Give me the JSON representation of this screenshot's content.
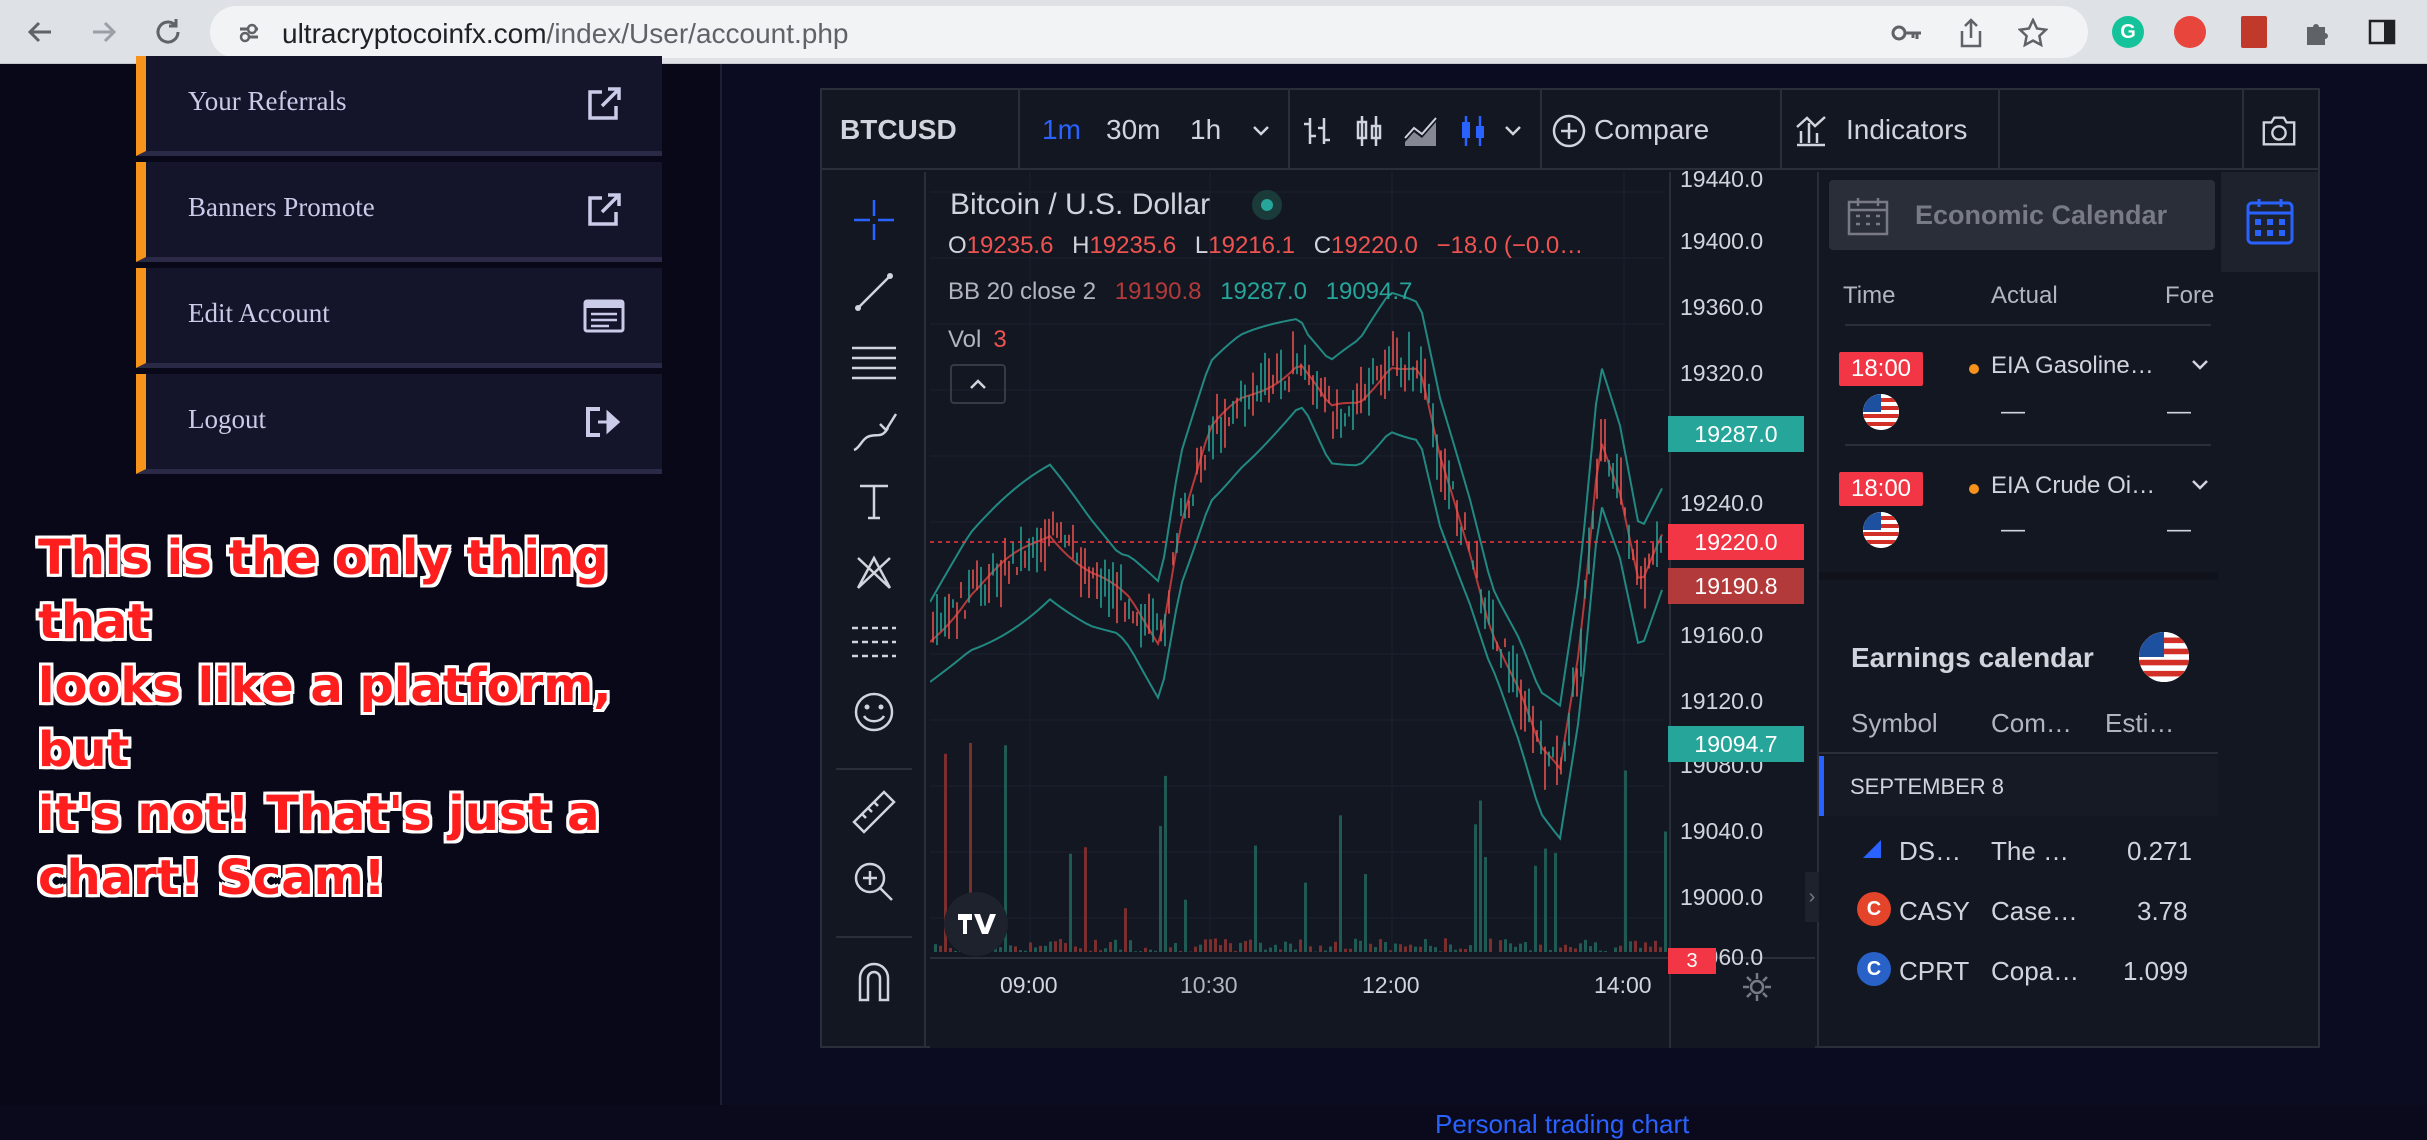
{
  "browser": {
    "url_domain": "ultracryptocoinfx.com",
    "url_path": "/index/User/account.php"
  },
  "sidebar": {
    "items": [
      {
        "label": "Your Referrals",
        "icon": "external-link-icon"
      },
      {
        "label": "Banners Promote",
        "icon": "external-link-icon"
      },
      {
        "label": "Edit Account",
        "icon": "account-card-icon"
      },
      {
        "label": "Logout",
        "icon": "logout-icon"
      }
    ]
  },
  "annotation": {
    "lines": [
      "This is the only thing that",
      "looks like a platform, but",
      "it's not! That's just a",
      "chart! Scam!"
    ]
  },
  "toolbar": {
    "symbol": "BTCUSD",
    "intervals": [
      "1m",
      "30m",
      "1h"
    ],
    "active_interval": "1m",
    "compare_label": "Compare",
    "indicators_label": "Indicators"
  },
  "chart": {
    "title": "Bitcoin / U.S. Dollar",
    "ohlc": {
      "o_label": "O",
      "o": "19235.6",
      "h_label": "H",
      "h": "19235.6",
      "l_label": "L",
      "l": "19216.1",
      "c_label": "C",
      "c": "19220.0",
      "change": "−18.0 (−0.0…"
    },
    "bb": {
      "label": "BB",
      "params": "20 close 2",
      "basis": "19190.8",
      "upper": "19287.0",
      "lower": "19094.7"
    },
    "vol": {
      "label": "Vol",
      "value": "3"
    },
    "y_ticks": [
      "19440.0",
      "19400.0",
      "19360.0",
      "19320.0",
      "19240.0",
      "19160.0",
      "19120.0",
      "19080.0",
      "19040.0",
      "19000.0",
      "18960.0"
    ],
    "price_tags": [
      {
        "value": "19287.0",
        "color": "#26a69a"
      },
      {
        "value": "19220.0",
        "color": "#f23645"
      },
      {
        "value": "19190.8",
        "color": "#b33a3a"
      },
      {
        "value": "19094.7",
        "color": "#26a69a"
      }
    ],
    "vol_tag": "3",
    "x_ticks": [
      "09:00",
      "10:30",
      "12:00",
      "14:00"
    ],
    "caption": "Personal trading chart"
  },
  "econ": {
    "title": "Economic Calendar",
    "cols": [
      "Time",
      "Actual",
      "Fore"
    ],
    "events": [
      {
        "time": "18:00",
        "name": "EIA Gasoline…",
        "actual": "—",
        "forecast": "—"
      },
      {
        "time": "18:00",
        "name": "EIA Crude Oi…",
        "actual": "—",
        "forecast": "—"
      }
    ]
  },
  "earnings": {
    "title": "Earnings calendar",
    "cols": [
      "Symbol",
      "Com…",
      "Esti…"
    ],
    "date": "SEPTEMBER 8",
    "rows": [
      {
        "symbol": "DS…",
        "company": "The …",
        "estimate": "0.271",
        "logo": "",
        "logo_color": "#2962ff"
      },
      {
        "symbol": "CASY",
        "company": "Case…",
        "estimate": "3.78",
        "logo": "C",
        "logo_color": "#e4442a"
      },
      {
        "symbol": "CPRT",
        "company": "Copa…",
        "estimate": "1.099",
        "logo": "C",
        "logo_color": "#2862c9"
      }
    ]
  },
  "colors": {
    "accent_orange": "#f7931a",
    "up": "#26a69a",
    "down": "#ef5350",
    "panel": "#131722",
    "link": "#2962ff"
  }
}
